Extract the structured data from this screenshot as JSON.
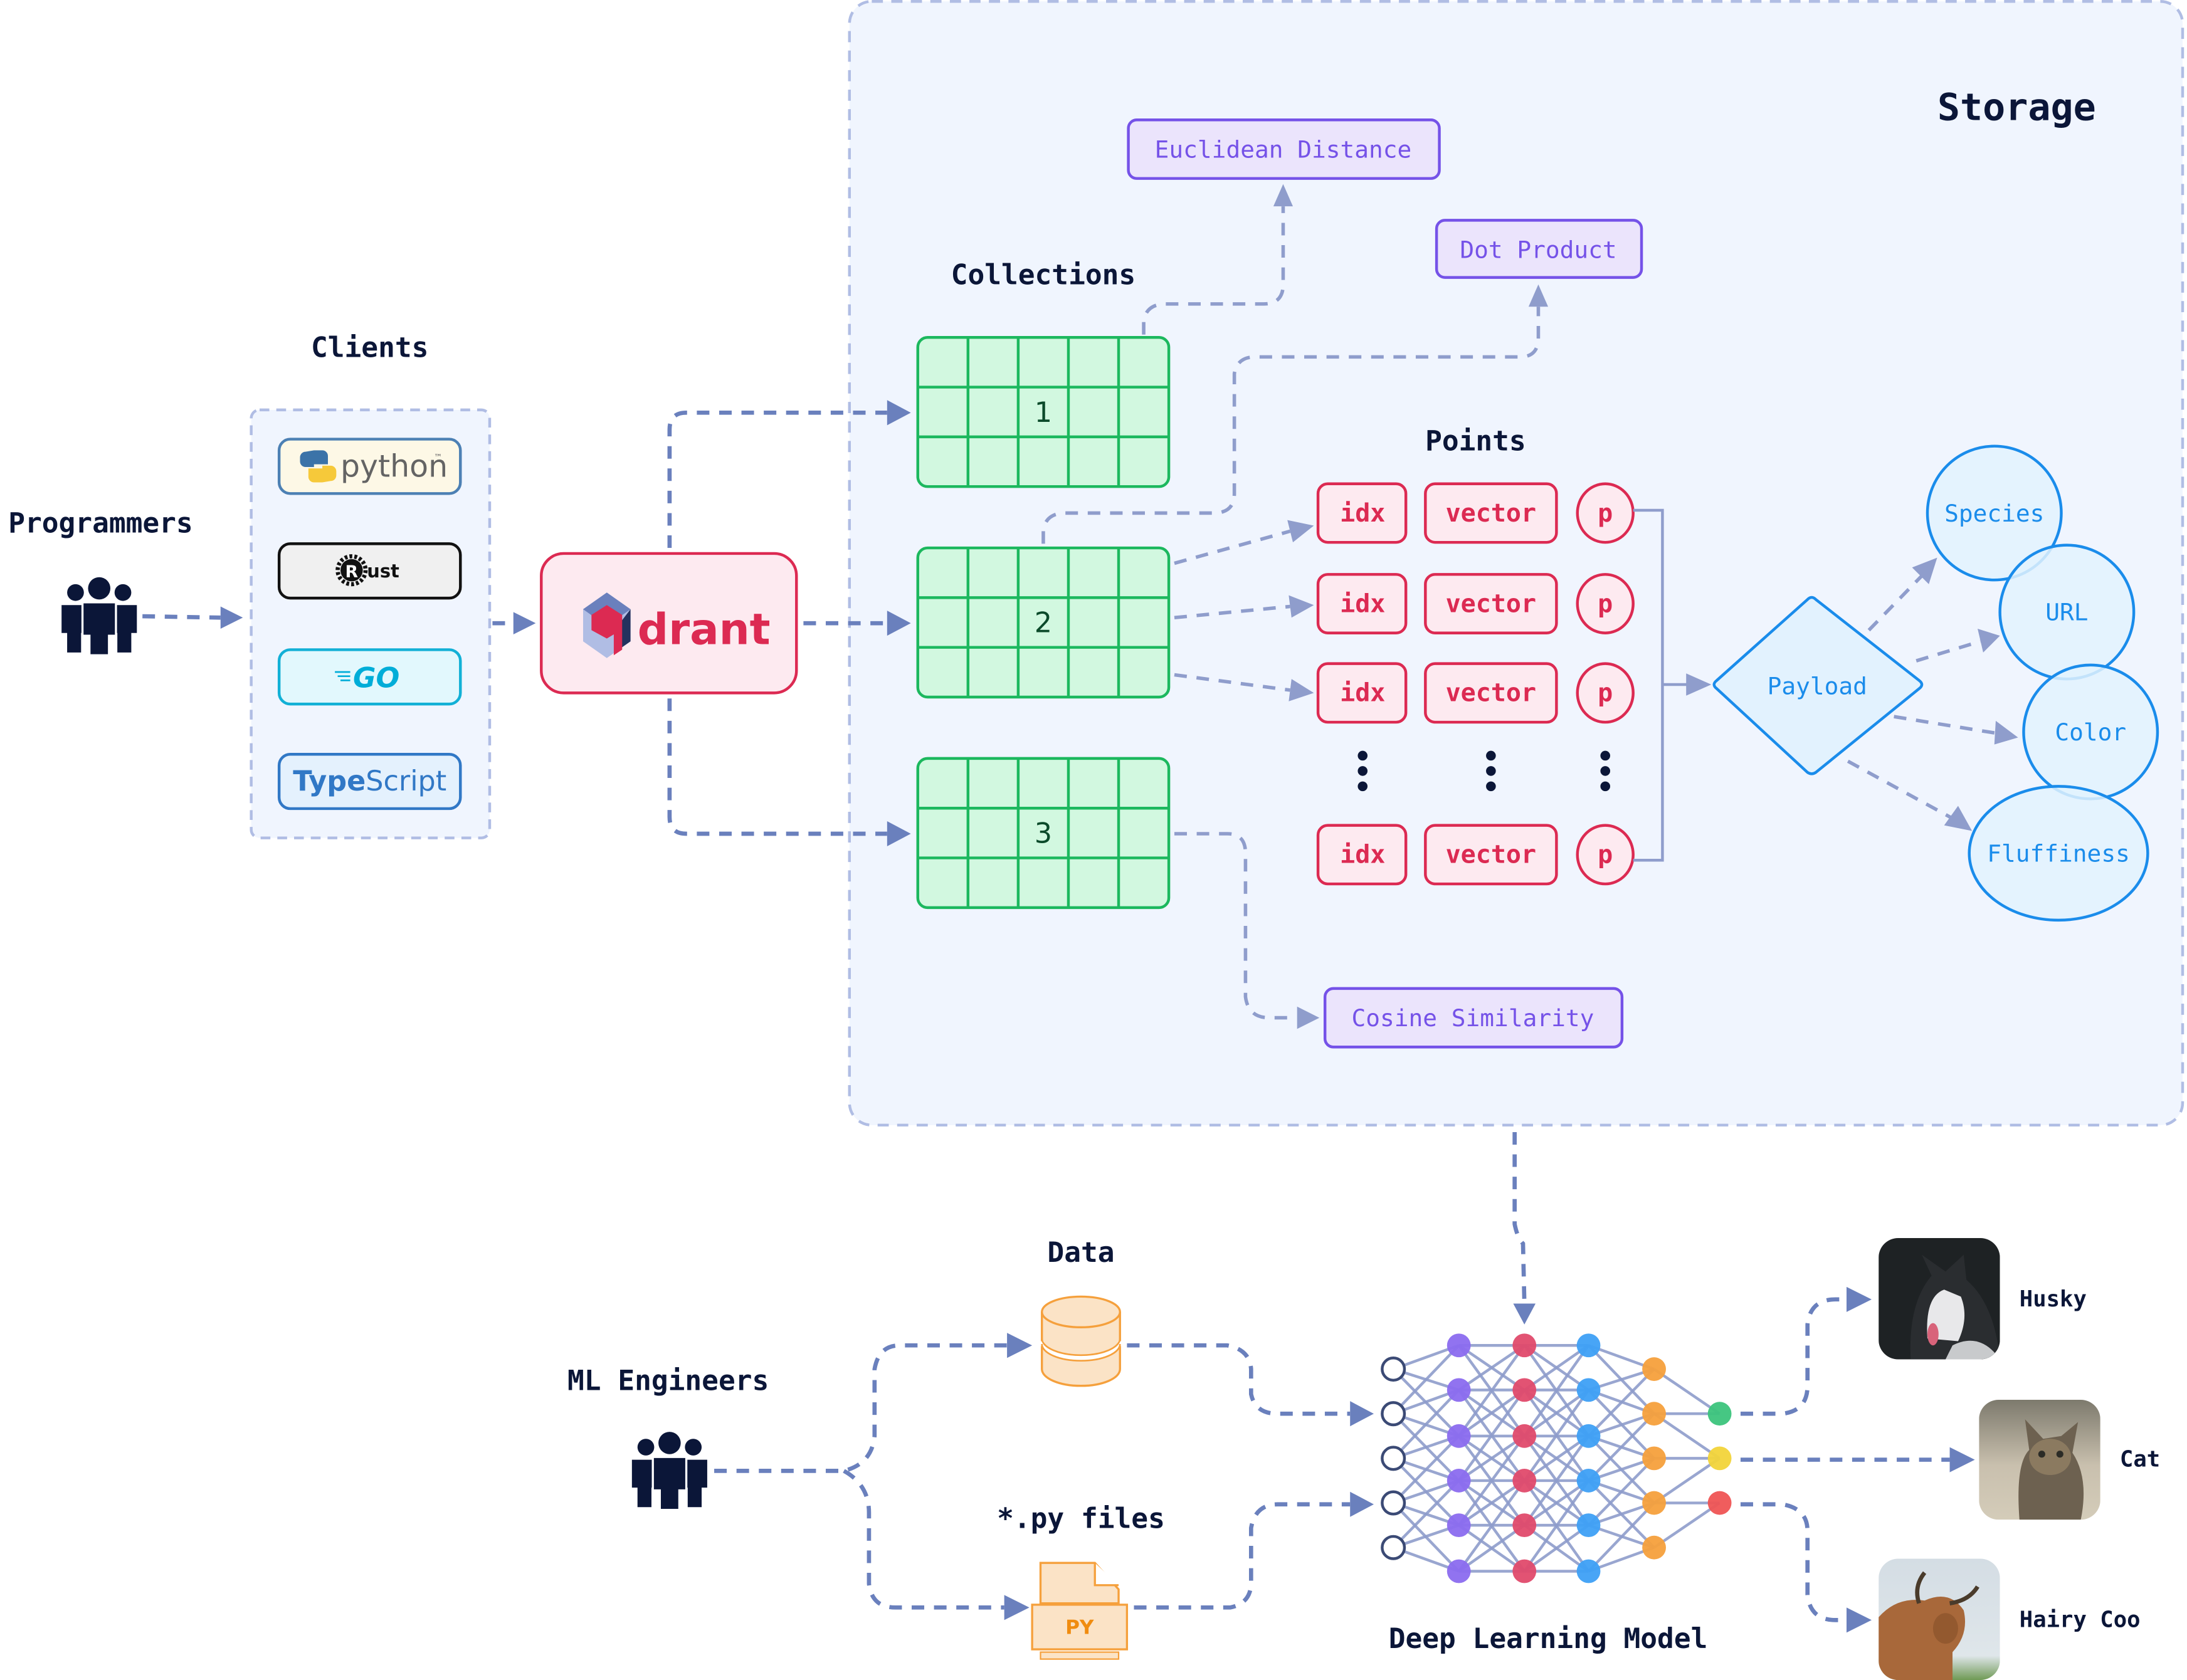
{
  "sections": {
    "storage_title": "Storage",
    "clients_title": "Clients",
    "programmers_title": "Programmers",
    "collections_title": "Collections",
    "points_title": "Points",
    "ml_engineers_title": "ML Engineers",
    "data_title": "Data",
    "py_files_title": "*.py files",
    "model_title": "Deep Learning Model"
  },
  "clients": [
    {
      "name": "python",
      "label": "python",
      "tm": "™",
      "bg": "#fdf8e6",
      "border": "#4c80b4",
      "color": "#646464"
    },
    {
      "name": "rust",
      "label": "ust",
      "logo_letter": "R",
      "bg": "#f0f0f0",
      "border": "#111111",
      "color": "#111111"
    },
    {
      "name": "go",
      "label": "GO",
      "bg": "#e2f8fd",
      "border": "#12b0d6",
      "color": "#00add8"
    },
    {
      "name": "typescript",
      "label_bold": "Type",
      "label_light": "Script",
      "bg": "#e4f1fd",
      "border": "#3178c6",
      "color": "#3178c6"
    }
  ],
  "qdrant": {
    "logo_text": "drant",
    "bg": "#fdeaf0",
    "border": "#dc2a52"
  },
  "collections": [
    {
      "id": "1"
    },
    {
      "id": "2"
    },
    {
      "id": "3"
    }
  ],
  "metrics": {
    "euclidean": "Euclidean Distance",
    "dot": "Dot Product",
    "cosine": "Cosine Similarity"
  },
  "points": {
    "rows": [
      {
        "idx": "idx",
        "vector": "vector",
        "payload": "p"
      },
      {
        "idx": "idx",
        "vector": "vector",
        "payload": "p"
      },
      {
        "idx": "idx",
        "vector": "vector",
        "payload": "p"
      },
      {
        "idx": "idx",
        "vector": "vector",
        "payload": "p"
      }
    ]
  },
  "payload": {
    "label": "Payload",
    "fields": [
      "Species",
      "URL",
      "Color",
      "Fluffiness"
    ]
  },
  "data_store": {
    "file_badge": "PY"
  },
  "predictions": [
    {
      "label": "Husky",
      "image": "husky-photo"
    },
    {
      "label": "Cat",
      "image": "cat-photo"
    },
    {
      "label": "Hairy Coo",
      "image": "highland-cow-photo"
    }
  ],
  "colors": {
    "edge": "#6a80bd",
    "storage_bg": "#f0f5fe",
    "nn_layers": [
      "#ffffff",
      "#8b6cef",
      "#e04a6c",
      "#3ea0f5",
      "#f5a03c",
      [
        "#3cc47c",
        "#f2d43a",
        "#ef5454"
      ]
    ]
  }
}
